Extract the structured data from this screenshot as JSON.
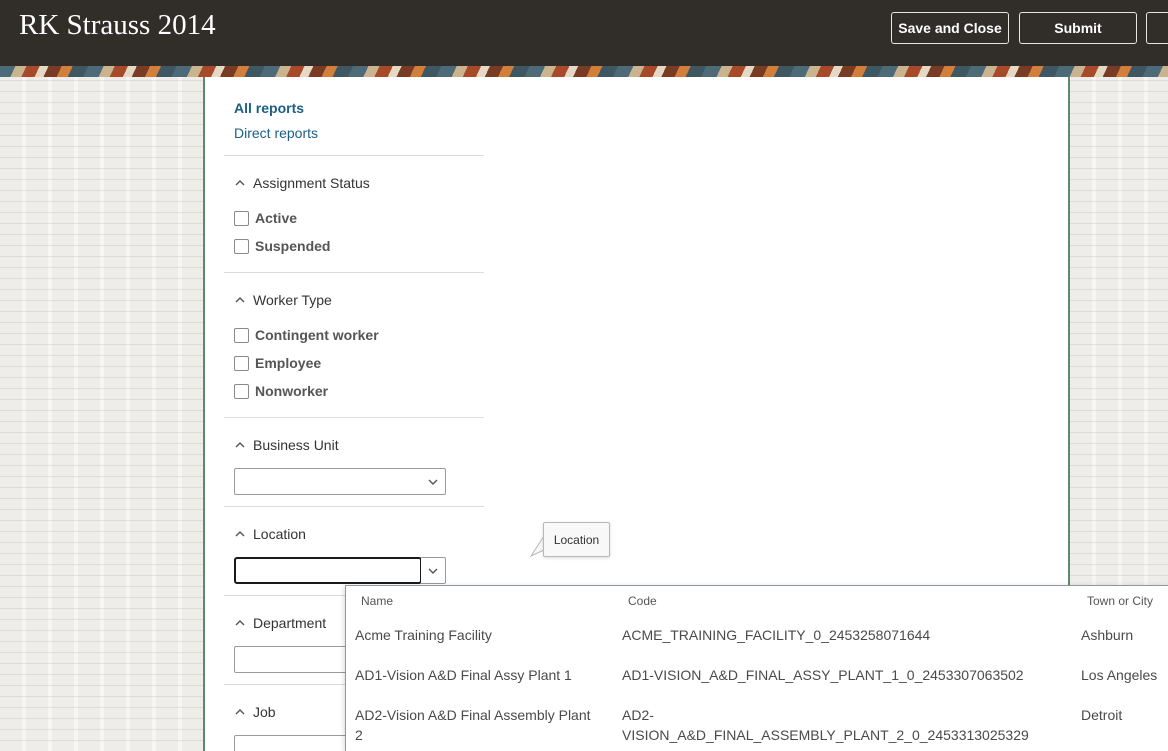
{
  "header": {
    "title": "RK Strauss 2014",
    "save_close_label": "Save and Close",
    "submit_label": "Submit"
  },
  "filters": {
    "all_reports": "All reports",
    "direct_reports": "Direct reports",
    "assignment_status": {
      "heading": "Assignment Status",
      "options": [
        "Active",
        "Suspended"
      ]
    },
    "worker_type": {
      "heading": "Worker Type",
      "options": [
        "Contingent worker",
        "Employee",
        "Nonworker"
      ]
    },
    "business_unit": {
      "heading": "Business Unit",
      "value": ""
    },
    "location": {
      "heading": "Location",
      "value": ""
    },
    "department": {
      "heading": "Department",
      "value": ""
    },
    "job": {
      "heading": "Job",
      "value": ""
    }
  },
  "tooltip": {
    "text": "Location"
  },
  "location_dropdown": {
    "columns": [
      "Name",
      "Code",
      "Town or City"
    ],
    "rows": [
      {
        "name": "Acme Training Facility",
        "code": "ACME_TRAINING_FACILITY_0_2453258071644",
        "city": "Ashburn"
      },
      {
        "name": "AD1-Vision A&D Final Assy Plant 1",
        "code": "AD1-VISION_A&D_FINAL_ASSY_PLANT_1_0_2453307063502",
        "city": "Los Angeles"
      },
      {
        "name_line1": "AD2-Vision A&D Final Assembly Plant",
        "name_line2": "2",
        "code_line1": "AD2-",
        "code_line2": "VISION_A&D_FINAL_ASSEMBLY_PLANT_2_0_2453313025329",
        "city": "Detroit"
      }
    ]
  },
  "colors": {
    "header_bg": "#312d29",
    "link": "#1b5e86",
    "card_border": "#5d8a6e"
  }
}
